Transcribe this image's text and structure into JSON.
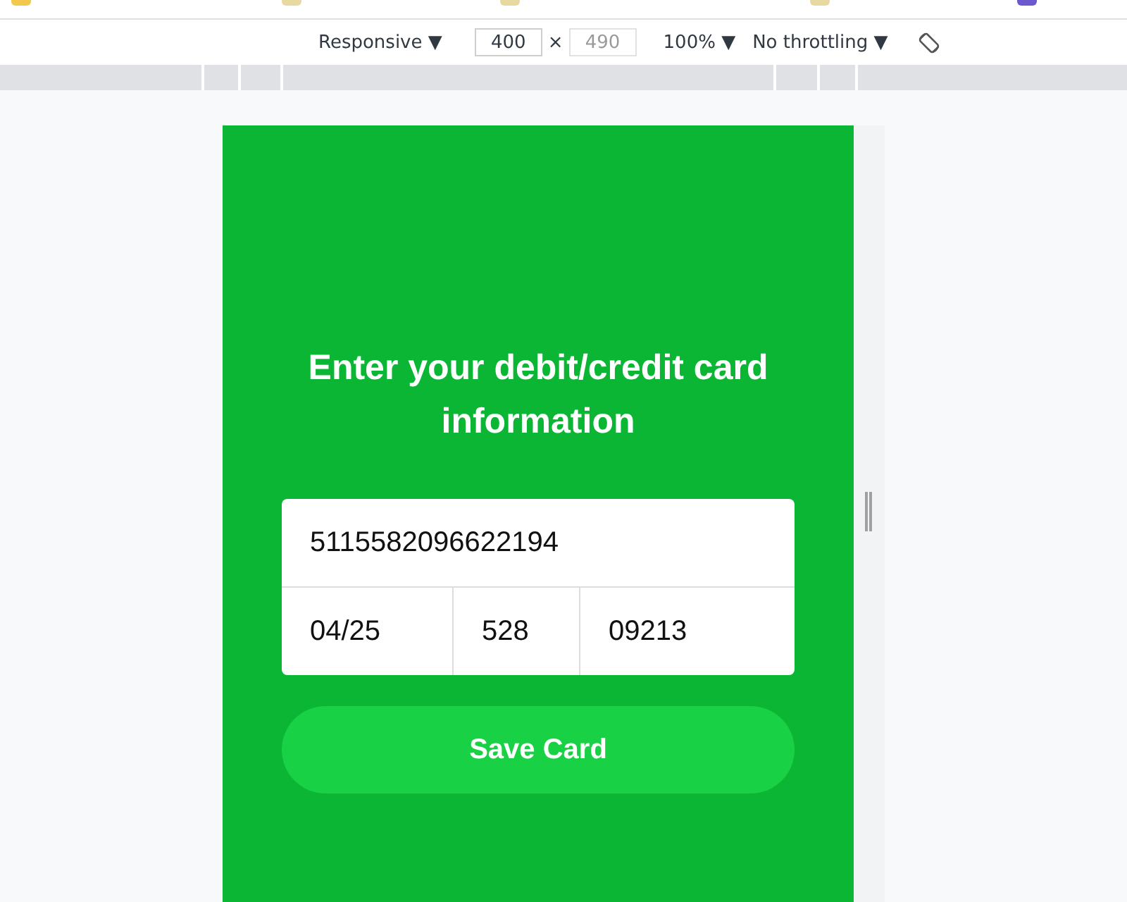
{
  "toolbar": {
    "device": "Responsive ▼",
    "width": {
      "value": "400",
      "disabled": false
    },
    "times": "×",
    "height": {
      "value": "490",
      "disabled": true
    },
    "zoom": "100% ▼",
    "throttling": "No throttling ▼"
  },
  "form": {
    "title": "Enter your debit/credit card information",
    "card_number": "5115582096622194",
    "fields": [
      {
        "value": "04/25"
      },
      {
        "value": "528"
      },
      {
        "value": "09213"
      }
    ],
    "button": "Save Card"
  }
}
